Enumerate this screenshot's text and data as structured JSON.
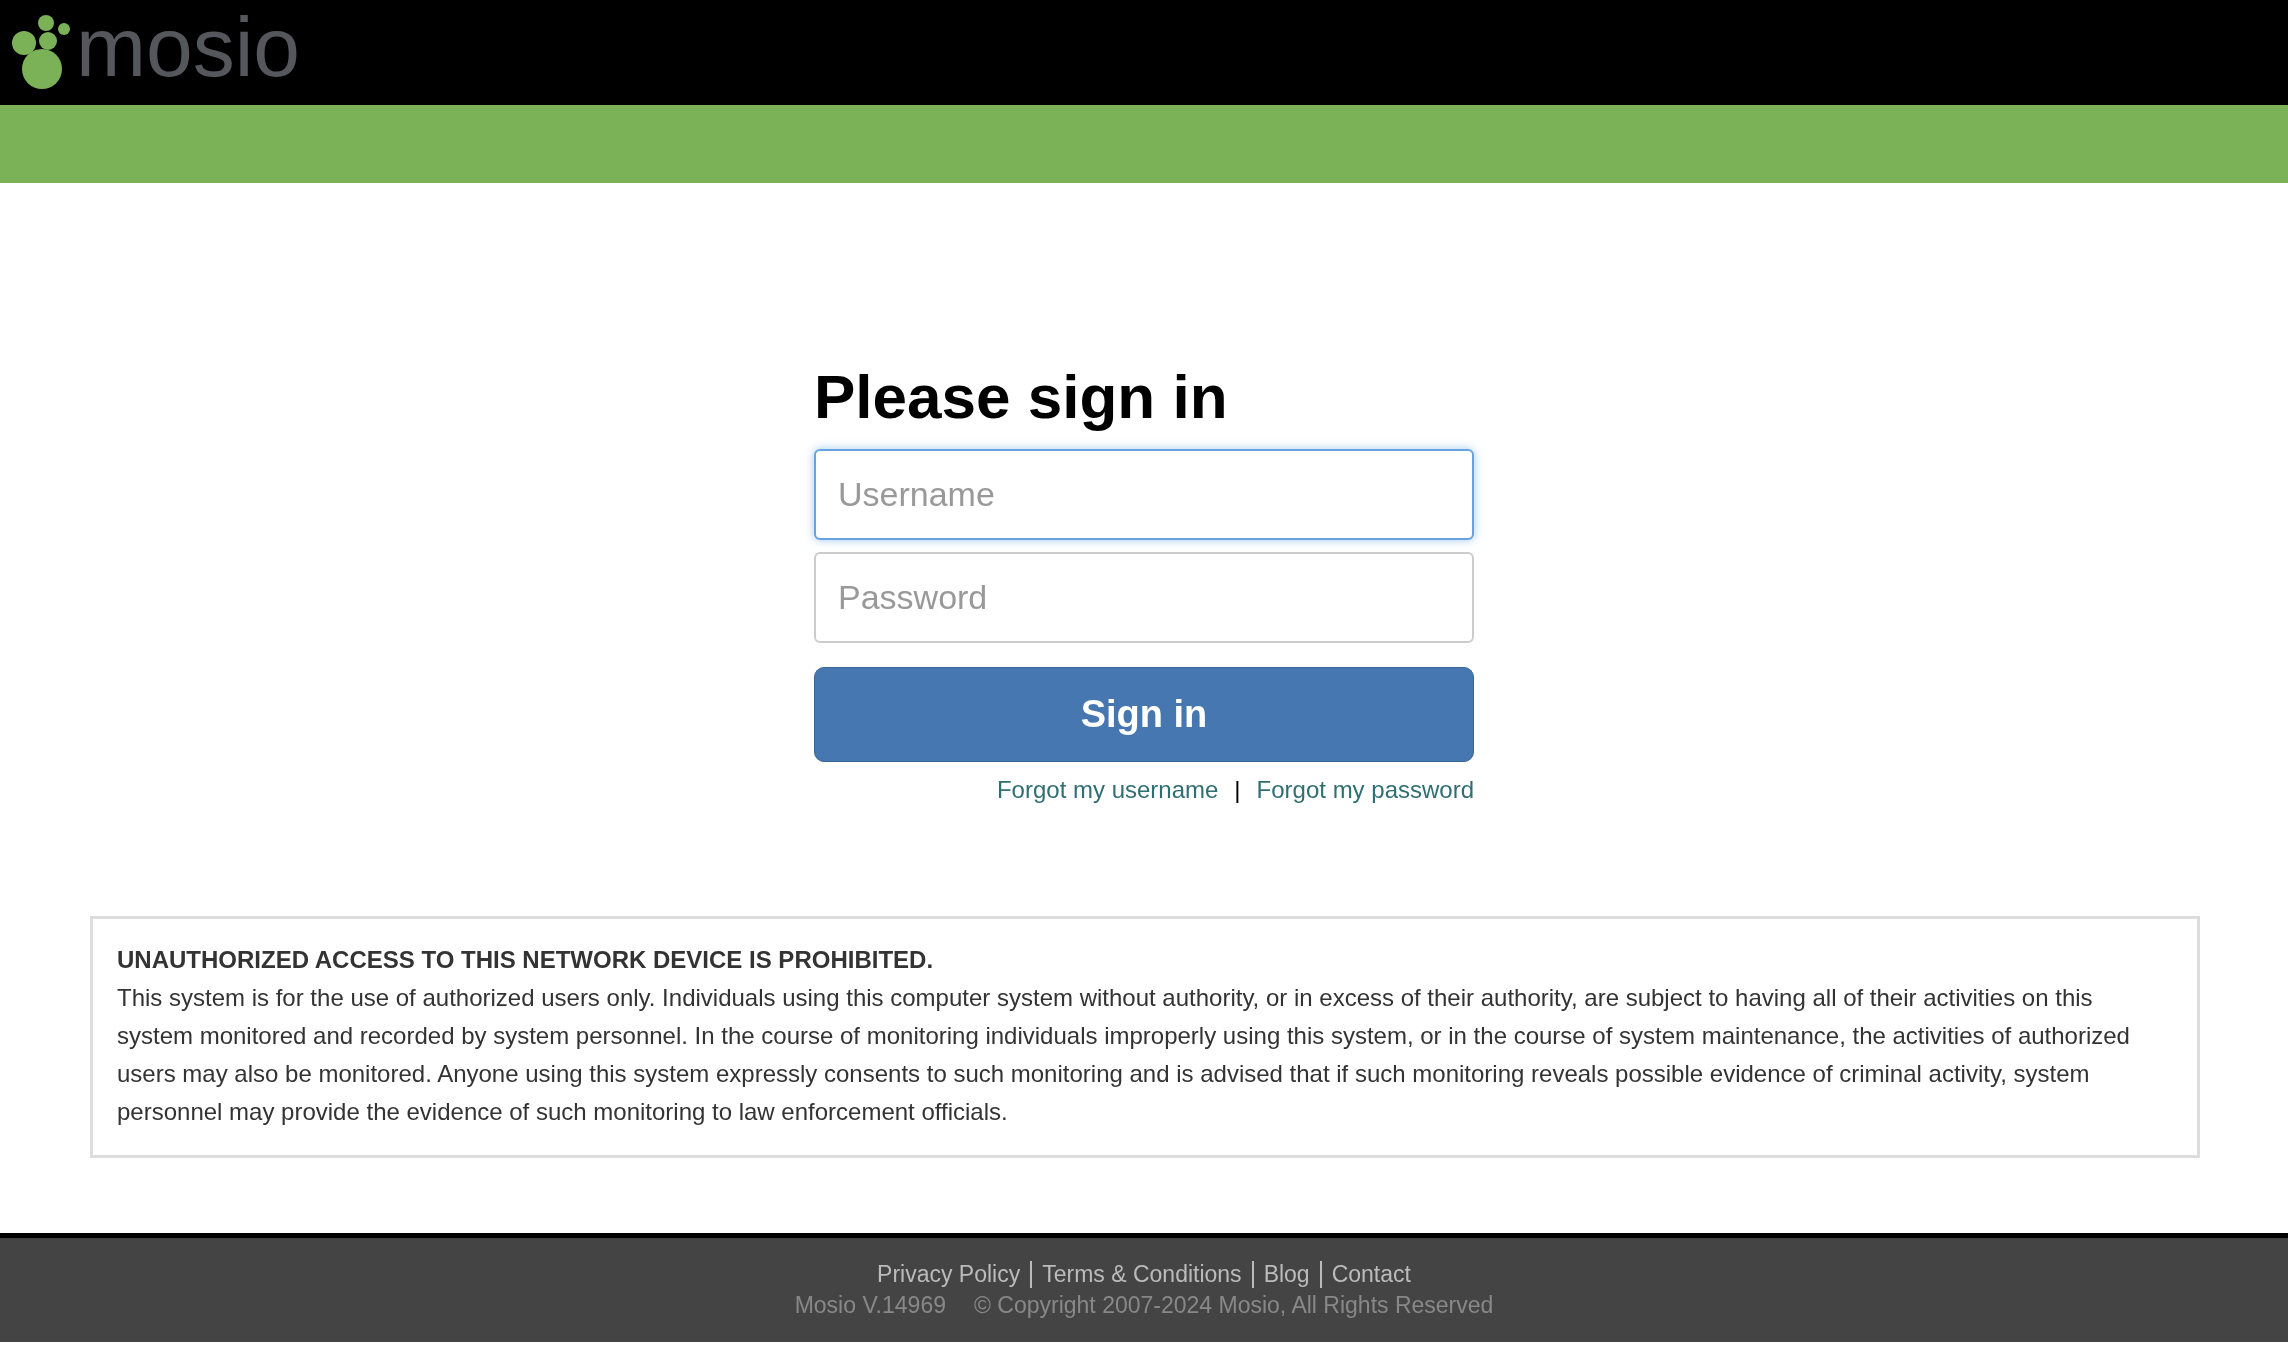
{
  "header": {
    "logo_text": "mosio"
  },
  "signin": {
    "title": "Please sign in",
    "fields": [
      {
        "placeholder": "Username",
        "focused": true
      },
      {
        "placeholder": "Password",
        "focused": false
      }
    ],
    "button": "Sign in",
    "links": [
      "Forgot my username",
      "Forgot my password"
    ],
    "separator": "|"
  },
  "notice": {
    "heading": "UNAUTHORIZED ACCESS TO THIS NETWORK DEVICE IS PROHIBITED.",
    "body": "This system is for the use of authorized users only. Individuals using this computer system without authority, or in excess of their authority, are subject to having all of their activities on this system monitored and recorded by system personnel. In the course of monitoring individuals improperly using this system, or in the course of system maintenance, the activities of authorized users may also be monitored. Anyone using this system expressly consents to such monitoring and is advised that if such monitoring reveals possible evidence of criminal activity, system personnel may provide the evidence of such monitoring to law enforcement officials."
  },
  "footer": {
    "links": [
      "Privacy Policy",
      "Terms & Conditions",
      "Blog",
      "Contact"
    ],
    "version": "Mosio V.14969",
    "copyright": "© Copyright 2007-2024 Mosio, All Rights Reserved"
  }
}
